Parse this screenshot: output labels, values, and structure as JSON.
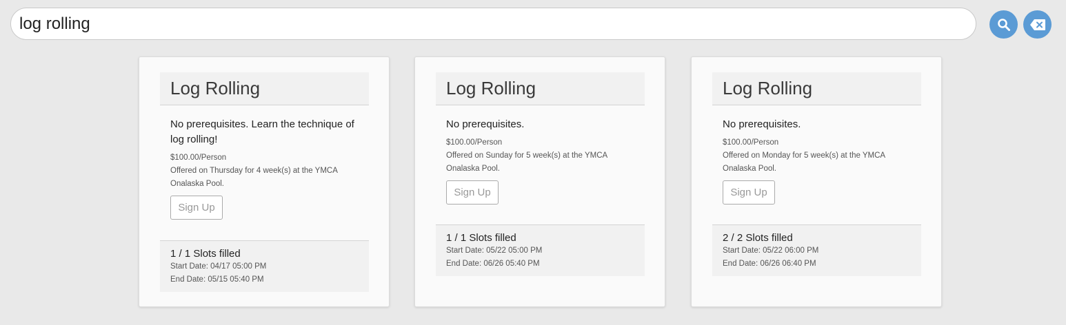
{
  "search": {
    "value": "log rolling",
    "search_icon": "search-icon",
    "clear_icon": "backspace-icon"
  },
  "colors": {
    "accent": "#5b9bd5",
    "background": "#e9e9e9",
    "card": "#fafafa"
  },
  "cards": [
    {
      "title": "Log Rolling",
      "description": "No prerequisites. Learn the technique of log rolling!",
      "price": "$100.00/Person",
      "schedule": "Offered on Thursday for 4 week(s) at the YMCA Onalaska Pool.",
      "signup_label": "Sign Up",
      "slots": "1 / 1 Slots filled",
      "start": "Start Date: 04/17 05:00 PM",
      "end": "End Date: 05/15 05:40 PM"
    },
    {
      "title": "Log Rolling",
      "description": "No prerequisites.",
      "price": "$100.00/Person",
      "schedule": "Offered on Sunday for 5 week(s) at the YMCA Onalaska Pool.",
      "signup_label": "Sign Up",
      "slots": "1 / 1 Slots filled",
      "start": "Start Date: 05/22 05:00 PM",
      "end": "End Date: 06/26 05:40 PM"
    },
    {
      "title": "Log Rolling",
      "description": "No prerequisites.",
      "price": "$100.00/Person",
      "schedule": "Offered on Monday for 5 week(s) at the YMCA Onalaska Pool.",
      "signup_label": "Sign Up",
      "slots": "2 / 2 Slots filled",
      "start": "Start Date: 05/22 06:00 PM",
      "end": "End Date: 06/26 06:40 PM"
    }
  ]
}
